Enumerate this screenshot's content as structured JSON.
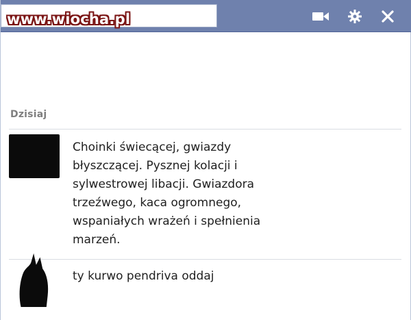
{
  "watermark": "www.wiocha.pl",
  "titlebar": {
    "icons": [
      "video-call-icon",
      "gear-icon",
      "close-icon"
    ],
    "color": "#6f81ad"
  },
  "conversation": {
    "day_label": "Dzisiaj",
    "messages": [
      {
        "lines": [
          "Choinki świecącej, gwiazdy",
          "błyszczącej. Pysznej kolacji i",
          "sylwestrowej libacji. Gwiazdora",
          "trzeźwego, kaca ogromnego,",
          "wspaniałych wrażeń i spełnienia",
          "marzeń."
        ]
      },
      {
        "lines": [
          "ty kurwo pendriva oddaj"
        ]
      }
    ]
  }
}
